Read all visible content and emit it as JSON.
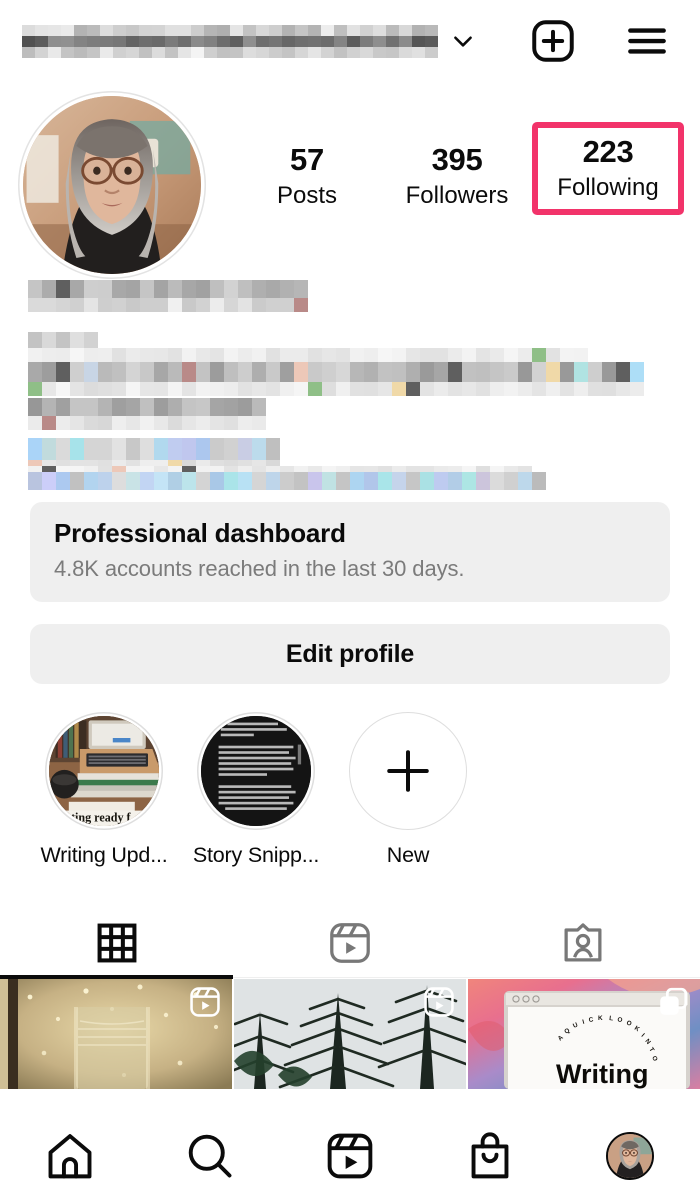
{
  "app": "Instagram profile",
  "header": {
    "username_redacted": true,
    "username_placeholder": "",
    "chevron_icon": "chevron-down-icon",
    "new_post_icon": "plus-square-icon",
    "menu_icon": "hamburger-menu-icon"
  },
  "profile": {
    "avatar_icon": "profile-avatar",
    "bio_redacted": true,
    "stats": [
      {
        "id": "posts",
        "value": "57",
        "label": "Posts",
        "highlighted": false
      },
      {
        "id": "followers",
        "value": "395",
        "label": "Followers",
        "highlighted": false
      },
      {
        "id": "following",
        "value": "223",
        "label": "Following",
        "highlighted": true
      }
    ],
    "highlight_color": "#f2336a"
  },
  "dashboard": {
    "title": "Professional dashboard",
    "subtitle": "4.8K accounts reached in the last 30 days."
  },
  "edit_profile": {
    "label": "Edit profile"
  },
  "story_highlights": [
    {
      "id": "writing-updates",
      "label": "Writing Upd...",
      "kind": "highlight"
    },
    {
      "id": "story-snippets",
      "label": "Story Snipp...",
      "kind": "highlight"
    },
    {
      "id": "new",
      "label": "New",
      "kind": "add",
      "icon": "plus-icon"
    }
  ],
  "tabs": [
    {
      "id": "grid",
      "icon": "grid-icon",
      "active": true
    },
    {
      "id": "reels",
      "icon": "reels-icon",
      "active": false
    },
    {
      "id": "tagged",
      "icon": "tagged-icon",
      "active": false
    }
  ],
  "posts": [
    {
      "id": "post-1",
      "badge": "reels-icon",
      "caption": ""
    },
    {
      "id": "post-2",
      "badge": "reels-icon",
      "caption": ""
    },
    {
      "id": "post-3",
      "badge": "carousel-icon",
      "overline": "A QUICK LOOK INTO",
      "title": "Writing"
    }
  ],
  "bottom_nav": [
    {
      "id": "home",
      "icon": "home-icon",
      "active": false
    },
    {
      "id": "search",
      "icon": "search-icon",
      "active": false
    },
    {
      "id": "reels",
      "icon": "reels-icon",
      "active": false
    },
    {
      "id": "shop",
      "icon": "shopping-bag-icon",
      "active": false
    },
    {
      "id": "profile",
      "icon": "profile-avatar-icon",
      "active": true
    }
  ]
}
